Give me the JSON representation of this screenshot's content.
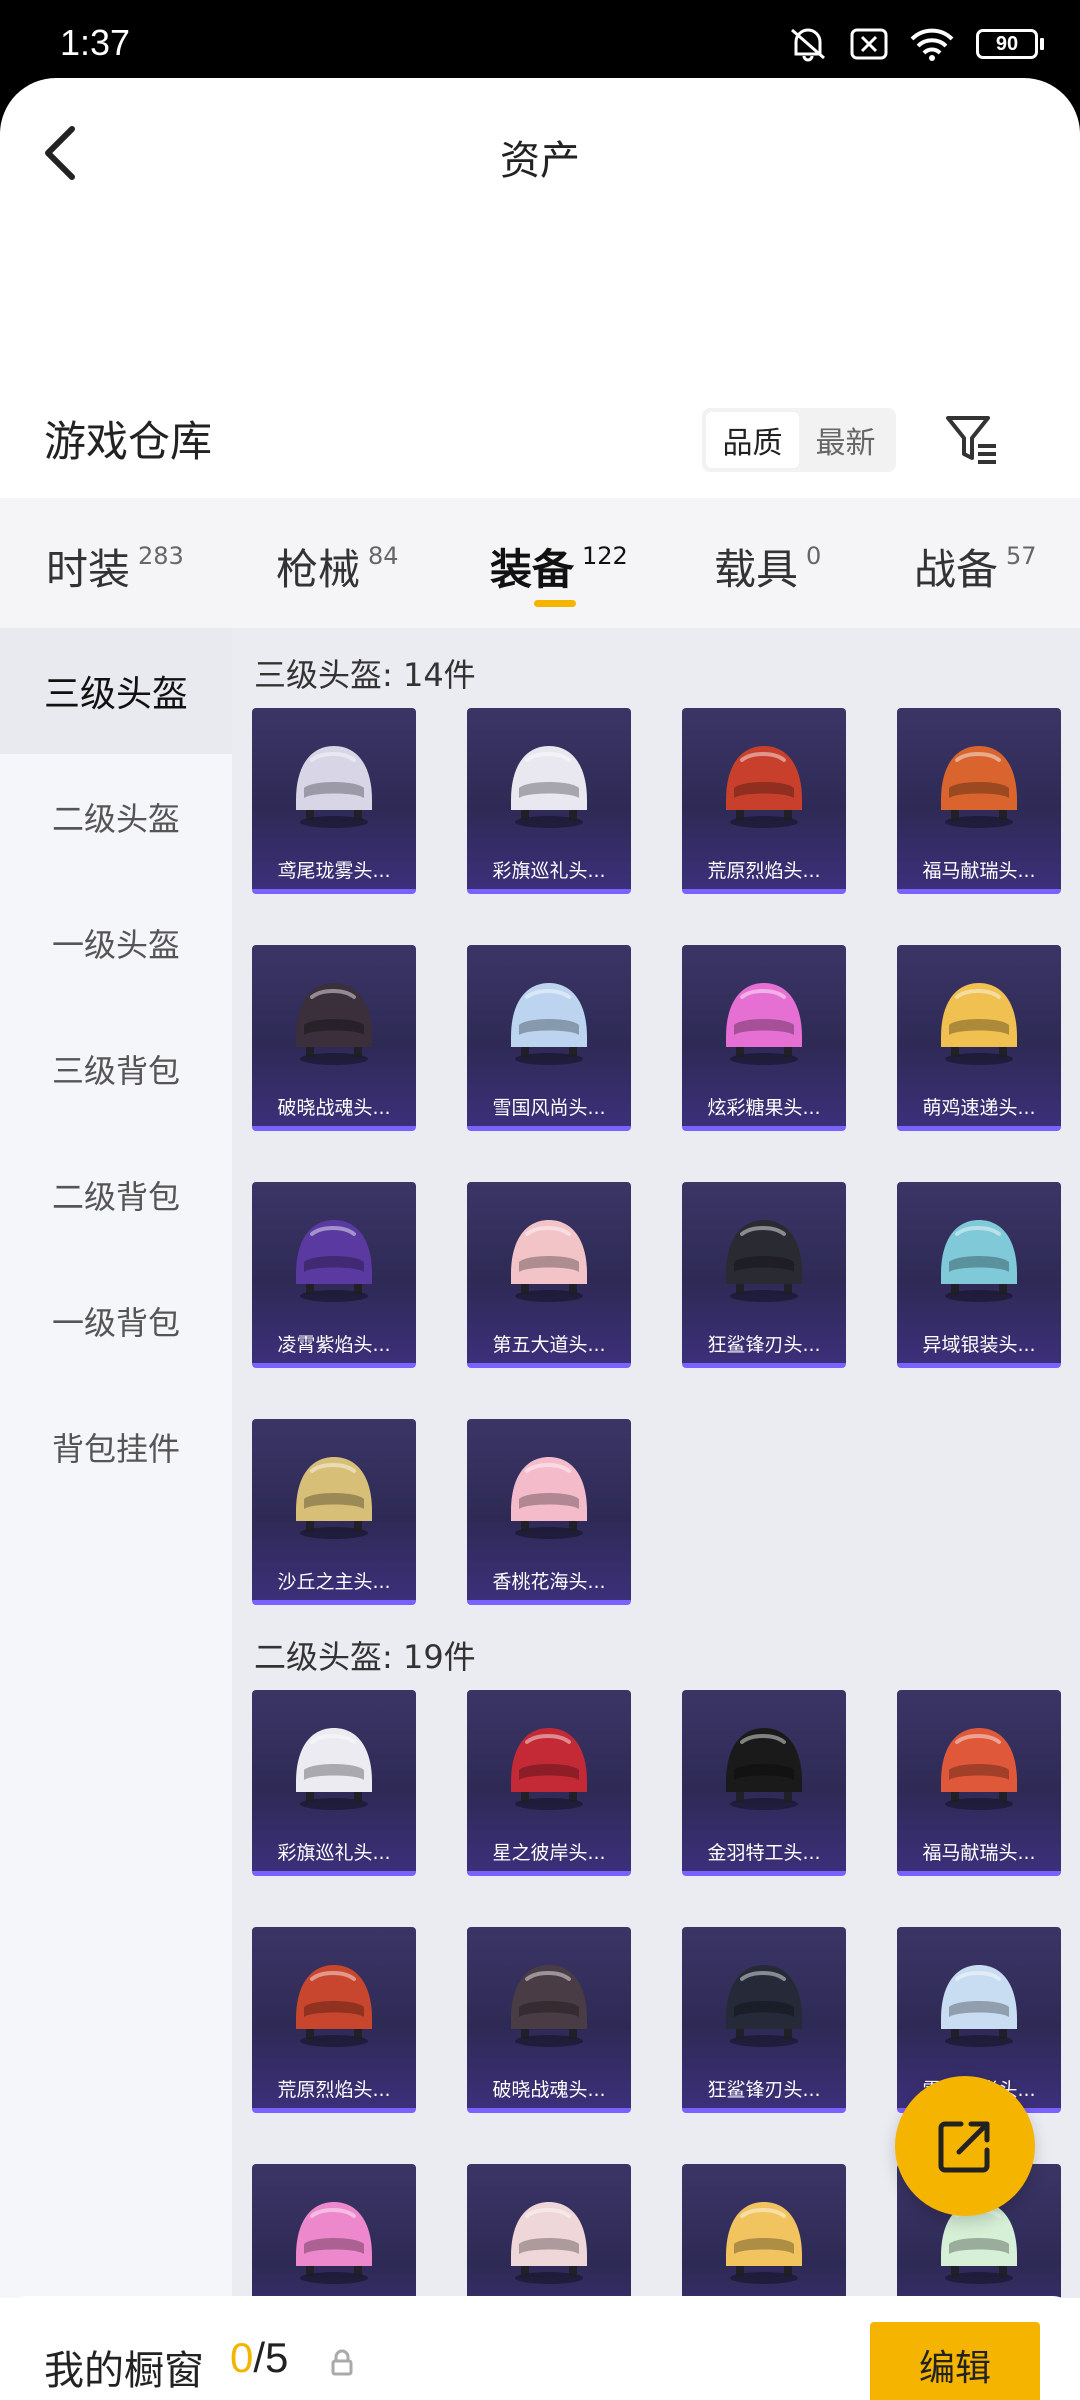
{
  "status_bar": {
    "time": "1:37",
    "battery": "90"
  },
  "nav": {
    "title": "资产"
  },
  "warehouse": {
    "title": "游戏仓库",
    "sort_options": [
      "品质",
      "最新"
    ],
    "active_sort": "品质"
  },
  "tabs": [
    {
      "label": "时装",
      "count": "283"
    },
    {
      "label": "枪械",
      "count": "84"
    },
    {
      "label": "装备",
      "count": "122",
      "active": true
    },
    {
      "label": "载具",
      "count": "0"
    },
    {
      "label": "战备",
      "count": "57"
    }
  ],
  "sidebar": [
    {
      "label": "三级头盔",
      "active": true
    },
    {
      "label": "二级头盔"
    },
    {
      "label": "一级头盔"
    },
    {
      "label": "三级背包"
    },
    {
      "label": "二级背包"
    },
    {
      "label": "一级背包"
    },
    {
      "label": "背包挂件"
    }
  ],
  "sections": [
    {
      "title": "三级头盔: 14件",
      "items": [
        {
          "name": "鸢尾珑雾头...",
          "color": "#d8d6e6"
        },
        {
          "name": "彩旗巡礼头...",
          "color": "#e9e7f0"
        },
        {
          "name": "荒原烈焰头...",
          "color": "#c8402c"
        },
        {
          "name": "福马献瑞头...",
          "color": "#d9642e"
        },
        {
          "name": "破晓战魂头...",
          "color": "#3a2f3a"
        },
        {
          "name": "雪国风尚头...",
          "color": "#bcd4f0"
        },
        {
          "name": "炫彩糖果头...",
          "color": "#e56fd2"
        },
        {
          "name": "萌鸡速递头...",
          "color": "#f0c050"
        },
        {
          "name": "凌霄紫焰头...",
          "color": "#5a3aa0"
        },
        {
          "name": "第五大道头...",
          "color": "#f2c4c8"
        },
        {
          "name": "狂鲨锋刃头...",
          "color": "#2a2a33"
        },
        {
          "name": "异域银装头...",
          "color": "#7fc9d8"
        },
        {
          "name": "沙丘之主头...",
          "color": "#d8bf78"
        },
        {
          "name": "香桃花海头...",
          "color": "#f4bccb"
        }
      ]
    },
    {
      "title": "二级头盔: 19件",
      "items": [
        {
          "name": "彩旗巡礼头...",
          "color": "#ecebf2"
        },
        {
          "name": "星之彼岸头...",
          "color": "#c42a36"
        },
        {
          "name": "金羽特工头...",
          "color": "#1a1a1a"
        },
        {
          "name": "福马献瑞头...",
          "color": "#e0583a"
        },
        {
          "name": "荒原烈焰头...",
          "color": "#c9462e"
        },
        {
          "name": "破晓战魂头...",
          "color": "#4a3c44"
        },
        {
          "name": "狂鲨锋刃头...",
          "color": "#262a38"
        },
        {
          "name": "雪国风尚头...",
          "color": "#c8dcf2"
        },
        {
          "name": "",
          "color": "#ee88cc"
        },
        {
          "name": "",
          "color": "#efd6d8"
        },
        {
          "name": "",
          "color": "#f2c460"
        },
        {
          "name": "",
          "color": "#d6f0d8"
        }
      ]
    }
  ],
  "showcase": {
    "label": "我的橱窗",
    "current": "0",
    "total": "/5",
    "edit_label": "编辑"
  }
}
